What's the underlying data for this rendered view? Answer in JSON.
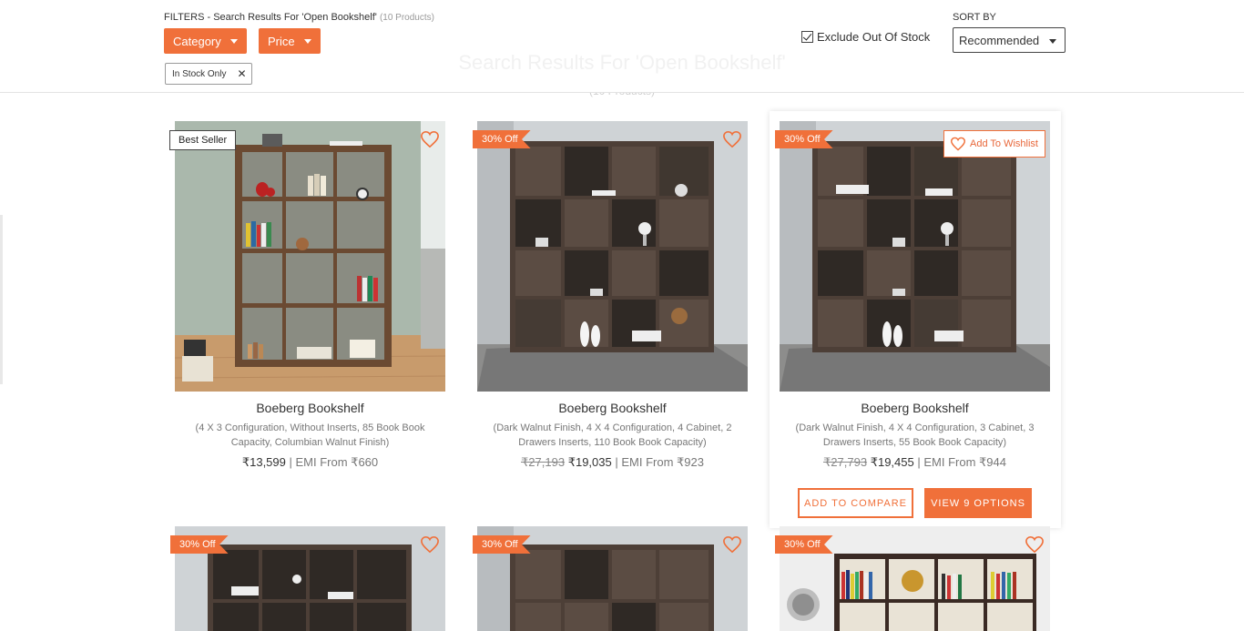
{
  "header": {
    "filters_label": "FILTERS - Search Results For 'Open Bookshelf'",
    "filters_count": "(10 Products)",
    "background_title": "Search Results For 'Open Bookshelf'",
    "background_subtitle": "(10 Products)",
    "category_label": "Category",
    "price_label": "Price",
    "chip_label": "In Stock Only",
    "exclude_label": "Exclude Out Of Stock",
    "sort_label": "SORT BY",
    "sort_value": "Recommended"
  },
  "colors": {
    "accent": "#f0703a",
    "wood_dark": "#4d3f37",
    "wood_light": "#6b4a32"
  },
  "products": [
    {
      "name": "Boeberg Bookshelf",
      "desc": "(4 X 3 Configuration, Without Inserts, 85 Book Book Capacity, Columbian Walnut Finish)",
      "old_price": "",
      "price": "₹13,599",
      "emi": "| EMI From ₹660",
      "badge": "Best Seller"
    },
    {
      "name": "Boeberg Bookshelf",
      "desc": "(Dark Walnut Finish, 4 X 4 Configuration, 4 Cabinet, 2 Drawers Inserts, 110 Book Book Capacity)",
      "old_price": "₹27,193",
      "price": "₹19,035",
      "emi": "| EMI From ₹923",
      "badge": "30% Off"
    },
    {
      "name": "Boeberg Bookshelf",
      "desc": "(Dark Walnut Finish, 4 X 4 Configuration, 3 Cabinet, 3 Drawers Inserts, 55 Book Book Capacity)",
      "old_price": "₹27,793",
      "price": "₹19,455",
      "emi": "| EMI From ₹944",
      "badge": "30% Off",
      "wishlist": "Add To Wishlist",
      "compare": "ADD TO COMPARE",
      "view": "VIEW 9 OPTIONS"
    }
  ],
  "row2_badges": [
    "30% Off",
    "30% Off",
    "30% Off"
  ]
}
